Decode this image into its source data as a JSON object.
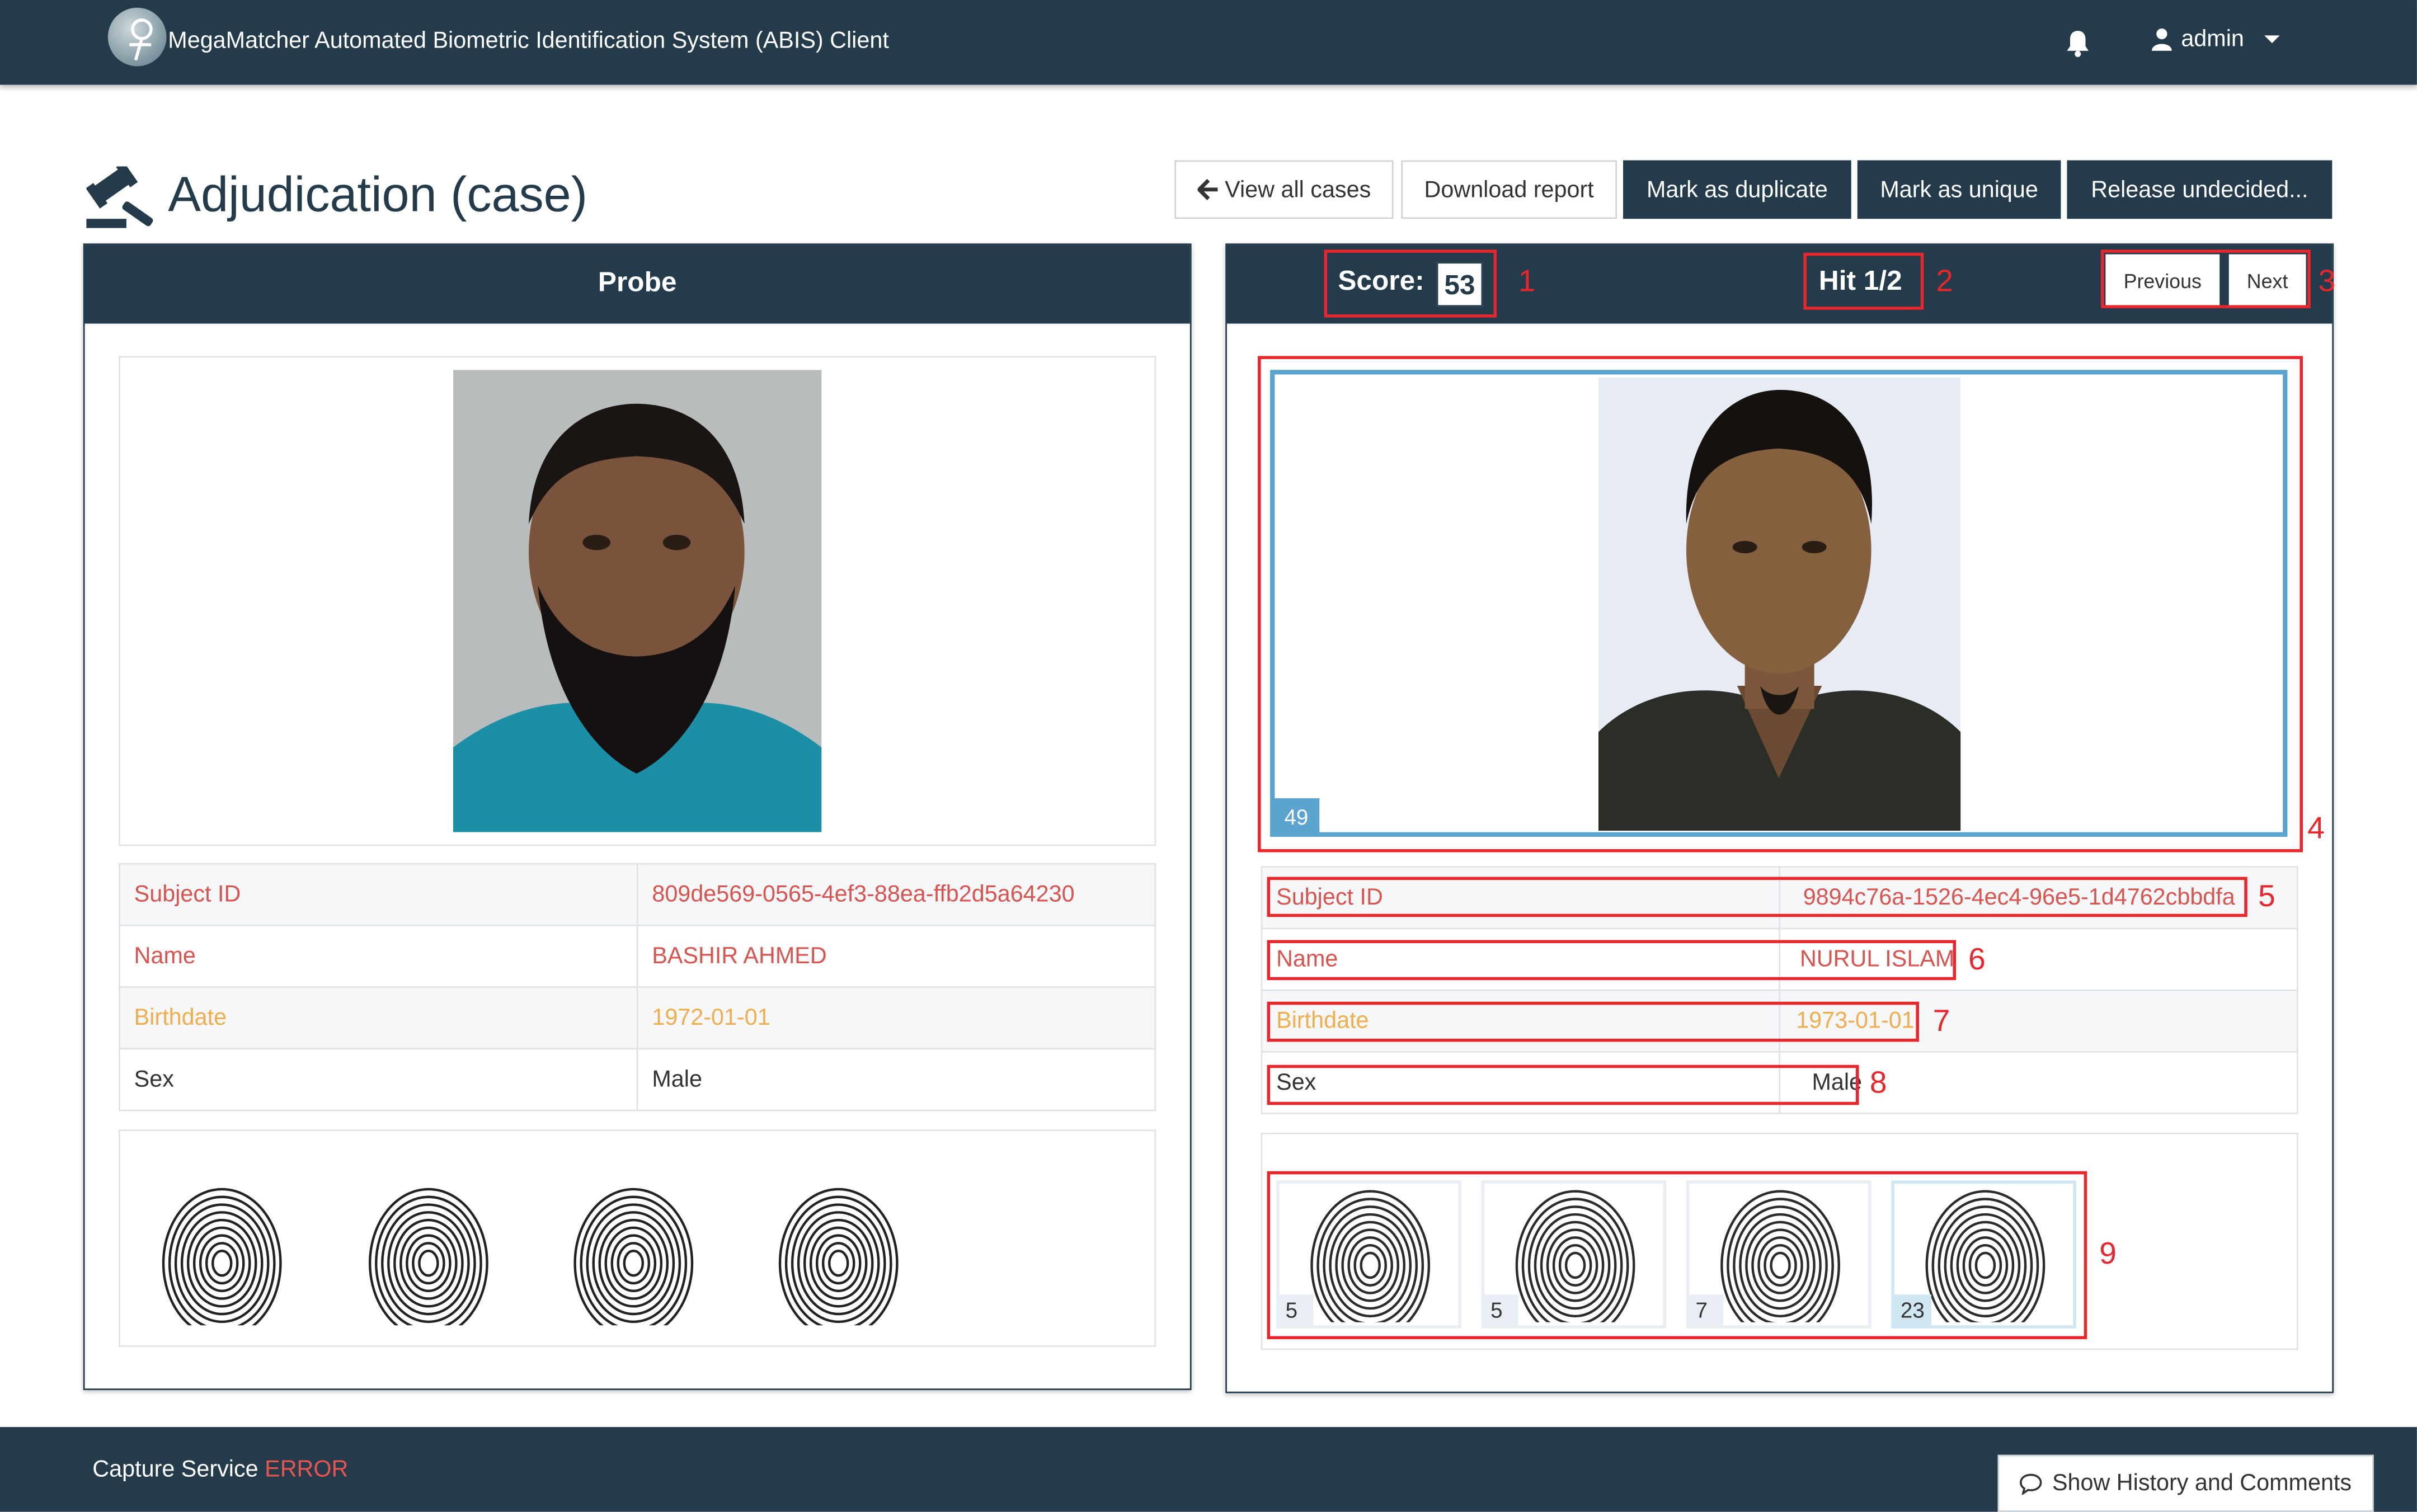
{
  "header": {
    "app_title": "MegaMatcher Automated Biometric Identification System (ABIS) Client",
    "logo_icon": "fingerprint-globe-logo",
    "notification_icon": "bell-icon",
    "user": {
      "icon": "user-icon",
      "name": "admin",
      "menu_icon": "caret-down-icon"
    }
  },
  "page": {
    "title": "Adjudication (case)",
    "title_icon": "gavel-icon"
  },
  "toolbar": {
    "view_all": {
      "icon": "arrow-left-icon",
      "label": "View all cases"
    },
    "download_report": "Download report",
    "mark_duplicate": "Mark as duplicate",
    "mark_unique": "Mark as unique",
    "release": "Release undecided..."
  },
  "probe": {
    "title": "Probe",
    "fields": [
      {
        "label": "Subject ID",
        "value": "809de569-0565-4ef3-88ea-ffb2d5a64230"
      },
      {
        "label": "Name",
        "value": "BASHIR AHMED"
      },
      {
        "label": "Birthdate",
        "value": "1972-01-01"
      },
      {
        "label": "Sex",
        "value": "Male"
      }
    ],
    "fingerprint_count": 4
  },
  "hit": {
    "score_label": "Score:",
    "score": "53",
    "hit_label": "Hit 1/2",
    "previous": "Previous",
    "next": "Next",
    "face_score": "49",
    "fields": [
      {
        "label": "Subject ID",
        "value": "9894c76a-1526-4ec4-96e5-1d4762cbbdfa"
      },
      {
        "label": "Name",
        "value": "NURUL ISLAM"
      },
      {
        "label": "Birthdate",
        "value": "1973-01-01"
      },
      {
        "label": "Sex",
        "value": "Male"
      }
    ],
    "fingerprint_scores": [
      "5",
      "5",
      "7",
      "23"
    ]
  },
  "annotations": [
    "1",
    "2",
    "3",
    "4",
    "5",
    "6",
    "7",
    "8",
    "9"
  ],
  "footer": {
    "capture_label": "Capture Service",
    "capture_status": "ERROR",
    "history_icon": "comment-icon",
    "history_button": "Show History and Comments"
  },
  "colors": {
    "navy": "#233b4a",
    "danger_red": "#d9534f",
    "warning_orange": "#f0ad4e",
    "annotation_red": "#e8262c",
    "face_frame_blue": "#5ba4cf"
  }
}
